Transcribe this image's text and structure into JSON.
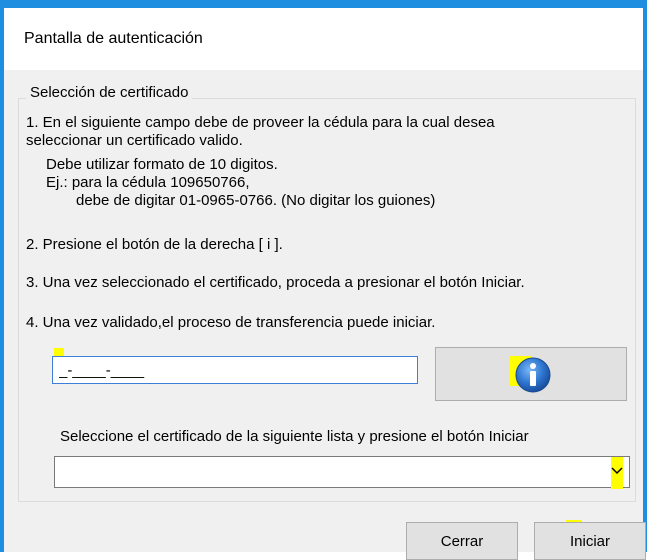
{
  "window": {
    "title": "Pantalla de autenticación",
    "accent_color": "#1e8fe0"
  },
  "groupbox": {
    "legend": "Selección de certificado",
    "step1_line1": "1. En el siguiente campo debe de proveer la  cédula para la cual desea",
    "step1_line2": "seleccionar un certificado valido.",
    "step1_line3": "Debe utilizar formato de 10 digitos.",
    "step1_line4": "Ej.: para la cédula 109650766,",
    "step1_line5": "debe de digitar 01-0965-0766. (No digitar los guiones)",
    "step2": "2. Presione el botón de la derecha [ i ].",
    "step3": "3. Una vez seleccionado el certificado, proceda a presionar el botón Iniciar.",
    "step4": "4. Una vez validado,el proceso de transferencia puede iniciar.",
    "cedula_input_value": "_-____-____",
    "info_button_icon": "info-icon",
    "select_label": "Seleccione el certificado de la siguiente lista y presione el botón Iniciar",
    "select_value": ""
  },
  "buttons": {
    "cerrar": "Cerrar",
    "iniciar": "Iniciar"
  },
  "highlight_color": "#ffff00"
}
